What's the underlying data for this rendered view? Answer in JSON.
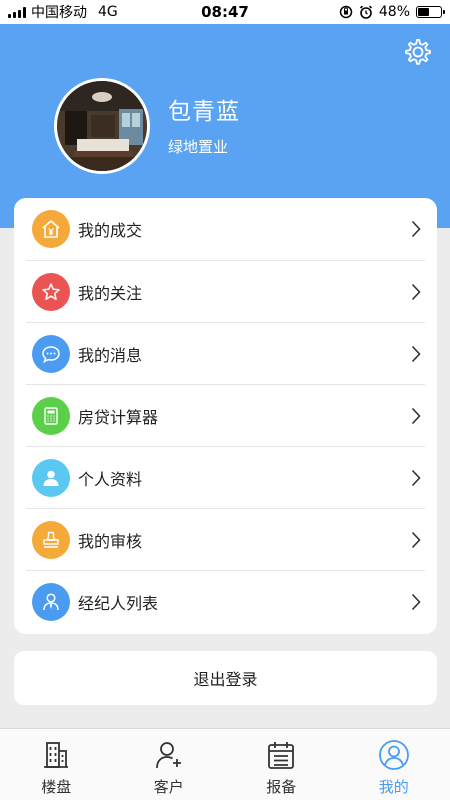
{
  "status_bar": {
    "carrier": "中国移动",
    "network": "4G",
    "time": "08:47",
    "battery": "48%",
    "battery_level": 0.48
  },
  "profile": {
    "name": "包青蓝",
    "company": "绿地置业"
  },
  "menu": {
    "items": [
      {
        "label": "我的成交",
        "icon": "house-yen-icon",
        "color": "#f5a938"
      },
      {
        "label": "我的关注",
        "icon": "star-icon",
        "color": "#ec5454"
      },
      {
        "label": "我的消息",
        "icon": "chat-bubble-icon",
        "color": "#4b9cf0"
      },
      {
        "label": "房贷计算器",
        "icon": "calculator-icon",
        "color": "#5ccf4a"
      },
      {
        "label": "个人资料",
        "icon": "person-icon",
        "color": "#5ac8f0"
      },
      {
        "label": "我的审核",
        "icon": "stamp-icon",
        "color": "#f5a938"
      },
      {
        "label": "经纪人列表",
        "icon": "agent-icon",
        "color": "#4b9cf0"
      }
    ]
  },
  "logout_label": "退出登录",
  "tabs": [
    {
      "label": "楼盘",
      "icon": "building-icon",
      "active": false
    },
    {
      "label": "客户",
      "icon": "add-person-icon",
      "active": false
    },
    {
      "label": "报备",
      "icon": "calendar-icon",
      "active": false
    },
    {
      "label": "我的",
      "icon": "profile-circle-icon",
      "active": true
    }
  ],
  "colors": {
    "header": "#5aa3f3",
    "active_tab": "#4a9bf2",
    "background": "#ececec"
  }
}
